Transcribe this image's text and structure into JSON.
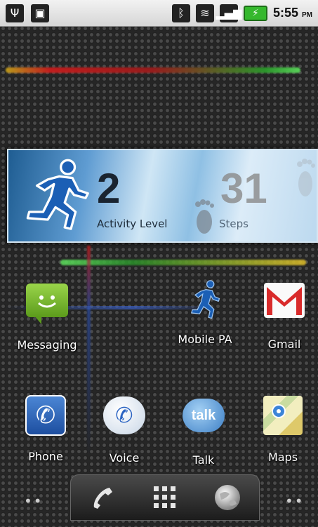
{
  "status_bar": {
    "time": "5:55",
    "ampm": "PM"
  },
  "widget": {
    "activity_value": "2",
    "activity_label": "Activity Level",
    "steps_value": "31",
    "steps_label": "Steps"
  },
  "apps_row1": [
    {
      "label": "Messaging"
    },
    {
      "label": "Mobile PA"
    },
    {
      "label": "Gmail"
    }
  ],
  "apps_row2": [
    {
      "label": "Phone"
    },
    {
      "label": "Voice"
    },
    {
      "label": "Talk"
    },
    {
      "label": "Maps"
    }
  ],
  "talk_icon_text": "talk",
  "dock_dots": "••"
}
